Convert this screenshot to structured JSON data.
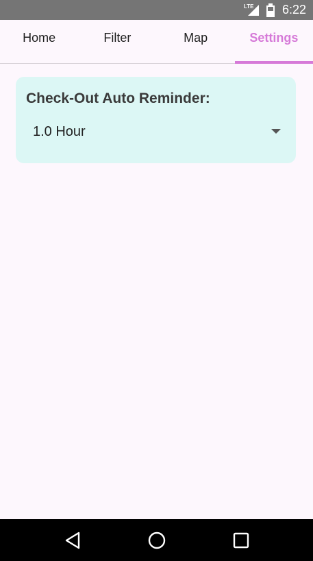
{
  "status_bar": {
    "network": "LTE",
    "time": "6:22"
  },
  "tabs": [
    {
      "label": "Home",
      "active": false
    },
    {
      "label": "Filter",
      "active": false
    },
    {
      "label": "Map",
      "active": false
    },
    {
      "label": "Settings",
      "active": true
    }
  ],
  "settings": {
    "reminder_title": "Check-Out Auto Reminder:",
    "reminder_value": "1.0 Hour"
  },
  "colors": {
    "accent": "#d67ad8",
    "card_bg": "#dcf7f5",
    "page_bg": "#fdf7fd",
    "status_bar": "#757575",
    "nav_bar": "#000000"
  },
  "icons": {
    "signal": "signal-icon",
    "battery": "battery-icon",
    "dropdown": "chevron-down-icon",
    "back": "back-icon",
    "home": "home-icon",
    "recents": "recents-icon"
  }
}
